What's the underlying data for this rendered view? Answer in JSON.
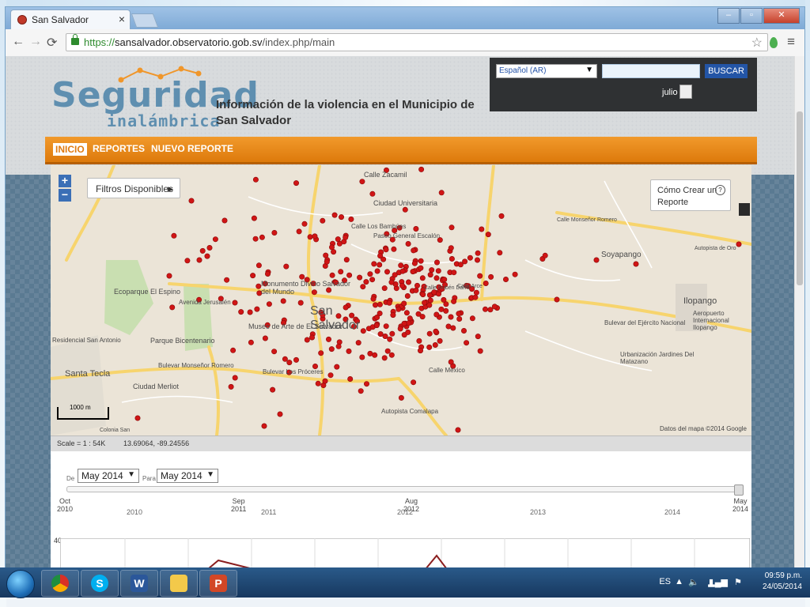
{
  "browser": {
    "tab_title": "San Salvador",
    "tab_close": "×",
    "url_secure": "https://",
    "url_domain": "sansalvador.observatorio.gob.sv",
    "url_path": "/index.php/main",
    "window_controls": [
      "–",
      "▫",
      "✕"
    ]
  },
  "site": {
    "logo_main": "Seguridad",
    "logo_sub": "inalámbrica",
    "title": "Información de la violencia en el Municipio de San Salvador"
  },
  "userbar": {
    "language": "Español (AR)",
    "search_placeholder": "",
    "search_button": "BUSCAR",
    "username": "julio"
  },
  "nav": {
    "items": [
      {
        "label": "INICIO",
        "active": true
      },
      {
        "label": "REPORTES",
        "active": false
      },
      {
        "label": "NUEVO REPORTE",
        "active": false
      }
    ]
  },
  "map": {
    "zoom_in": "+",
    "zoom_out": "−",
    "filters_button": "Filtros Disponibles",
    "how_to_button": "Cómo Crear un Reporte",
    "attribution": "Datos del mapa ©2014 Google",
    "scale_label": "1000 m",
    "labels": [
      "Calle Zacamil",
      "Ciudad Universitaria",
      "Calle Los Bambúes",
      "Paseo General Escalón",
      "Monumento Divino Salvador del Mundo",
      "Museo de Arte de El Salvador",
      "San Salvador",
      "Ecoparque El Espino",
      "Parque Bicentenario",
      "Santa Tecla",
      "Ciudad Merliot",
      "Bulevar Monseñor Romero",
      "Bulevar Los Próceres",
      "Calle México",
      "Autopista Comalapa",
      "Soyapango",
      "Ilopango",
      "Aeropuerto Internacional Ilopango",
      "Bulevar del Ejército Nacional",
      "Urbanización Jardines Del Matazano",
      "Autopista de Oro",
      "Calle Monseñor Romero",
      "Calle Arce",
      "Residencial San Antonio",
      "Colonia San",
      "Avenida Jerusalén",
      "Calle Rubén Darío"
    ],
    "status_scale": "Scale = 1 : 54K",
    "status_coords": "13.69064, -89.24556"
  },
  "timeline": {
    "from_label": "De",
    "to_label": "Para",
    "from_value": "May 2014",
    "to_value": "May 2014",
    "ticks": [
      {
        "line1": "Oct",
        "line2": "2010"
      },
      {
        "line1": "Sep",
        "line2": "2011"
      },
      {
        "line1": "Aug",
        "line2": "2012"
      },
      {
        "line1": "May",
        "line2": "2014"
      }
    ],
    "years": [
      "2010",
      "2011",
      "2012",
      "2013",
      "2014"
    ],
    "chart_ymax": "40"
  },
  "taskbar": {
    "apps": [
      "chrome",
      "skype",
      "word",
      "file-explorer",
      "powerpoint"
    ],
    "app_letters": {
      "word": "W",
      "powerpoint": "P",
      "skype": "S"
    },
    "language": "ES",
    "time": "09:59 p.m.",
    "date": "24/05/2014"
  }
}
